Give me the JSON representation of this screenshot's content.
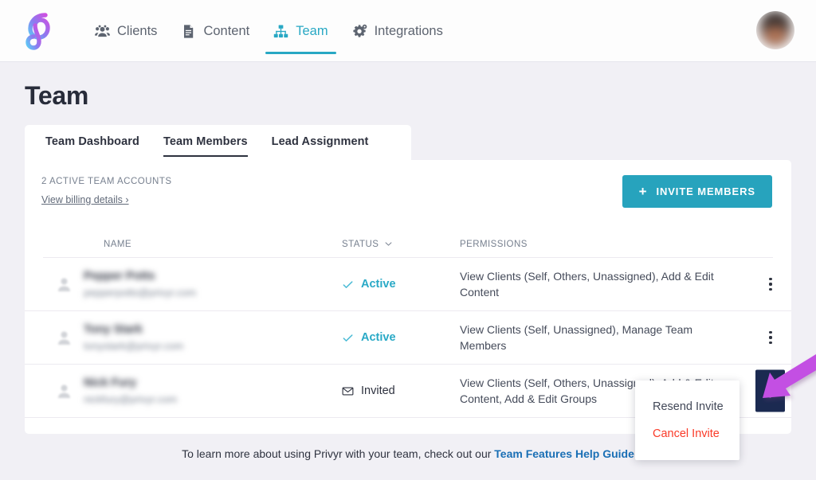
{
  "brand": {
    "logo_name": "privyr-logo",
    "accent_teal": "#27a3bd",
    "accent_cyan": "#29a9c6",
    "danger_red": "#fa3a28",
    "dark_navy": "#1b2a51",
    "annotation_purple": "#c24fe0"
  },
  "topnav": {
    "items": [
      {
        "label": "Clients",
        "icon": "people-group-icon",
        "active": false
      },
      {
        "label": "Content",
        "icon": "document-icon",
        "active": false
      },
      {
        "label": "Team",
        "icon": "org-chart-icon",
        "active": true
      },
      {
        "label": "Integrations",
        "icon": "gears-icon",
        "active": false
      }
    ],
    "avatar_alt": "user-avatar"
  },
  "page": {
    "title": "Team"
  },
  "tabs": [
    {
      "label": "Team Dashboard",
      "active": false
    },
    {
      "label": "Team Members",
      "active": true
    },
    {
      "label": "Lead Assignment",
      "active": false
    }
  ],
  "card": {
    "accounts_label": "2 ACTIVE TEAM ACCOUNTS",
    "billing_link": "View billing details ›",
    "invite_button": "INVITE MEMBERS",
    "invite_plus": "+"
  },
  "table": {
    "columns": {
      "name": "NAME",
      "status": "STATUS",
      "permissions": "PERMISSIONS"
    },
    "status_sortable": true,
    "rows": [
      {
        "name": "Pepper Potts",
        "email": "pepperpotts@privyr.com",
        "name_redacted": true,
        "status": "Active",
        "status_icon": "check-icon",
        "permissions": "View Clients (Self, Others, Unassigned), Add & Edit Content",
        "menu_open": false
      },
      {
        "name": "Tony Stark",
        "email": "tonystark@privyr.com",
        "name_redacted": true,
        "status": "Active",
        "status_icon": "check-icon",
        "permissions": "View Clients (Self, Unassigned), Manage Team Members",
        "menu_open": false
      },
      {
        "name": "Nick Fury",
        "email": "nickfury@privyr.com",
        "name_redacted": true,
        "status": "Invited",
        "status_icon": "envelope-icon",
        "permissions": "View Clients (Self, Others, Unassigned), Add & Edit Content, Add & Edit Groups",
        "menu_open": true
      }
    ]
  },
  "dropdown": {
    "items": [
      {
        "label": "Resend Invite",
        "danger": false
      },
      {
        "label": "Cancel Invite",
        "danger": true
      }
    ]
  },
  "footer": {
    "text": "To learn more about using Privyr with your team, check out our ",
    "link": "Team Features Help Guide"
  },
  "annotation": {
    "type": "arrow",
    "points_at": "row-3-kebab-menu-button"
  }
}
